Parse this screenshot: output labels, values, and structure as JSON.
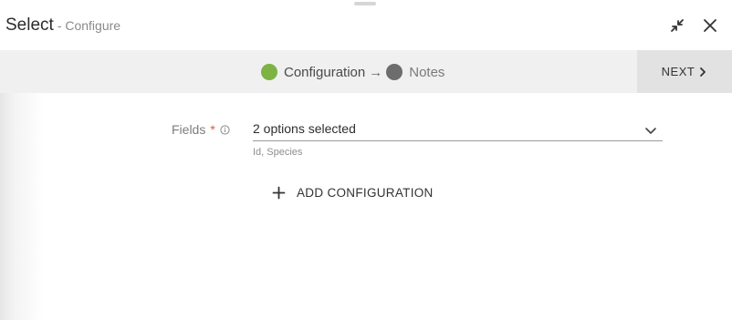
{
  "header": {
    "title": "Select",
    "subtitle": "- Configure",
    "collapse_icon": "collapse-arrows-icon",
    "close_icon": "close-icon"
  },
  "steps": {
    "items": [
      {
        "label": "Configuration",
        "color": "#7cb342",
        "state": "active"
      },
      {
        "label": "Notes",
        "color": "#6d6d6d",
        "state": "inactive"
      }
    ],
    "separator": "→",
    "next_label": "NEXT",
    "next_icon": "chevron-right-icon"
  },
  "form": {
    "fields_label": "Fields",
    "required_mark": "*",
    "info_icon": "info-icon",
    "selected_value": "2 options selected",
    "selected_hint": "Id, Species",
    "dropdown_icon": "chevron-down-icon"
  },
  "actions": {
    "add_configuration_label": "ADD CONFIGURATION",
    "add_icon": "plus-icon"
  },
  "colors": {
    "accent_required": "#e05a3a",
    "step_active": "#7cb342",
    "step_inactive": "#6d6d6d",
    "stepbar_bg": "#f0f0f0",
    "next_bg": "#e2e2e2"
  }
}
